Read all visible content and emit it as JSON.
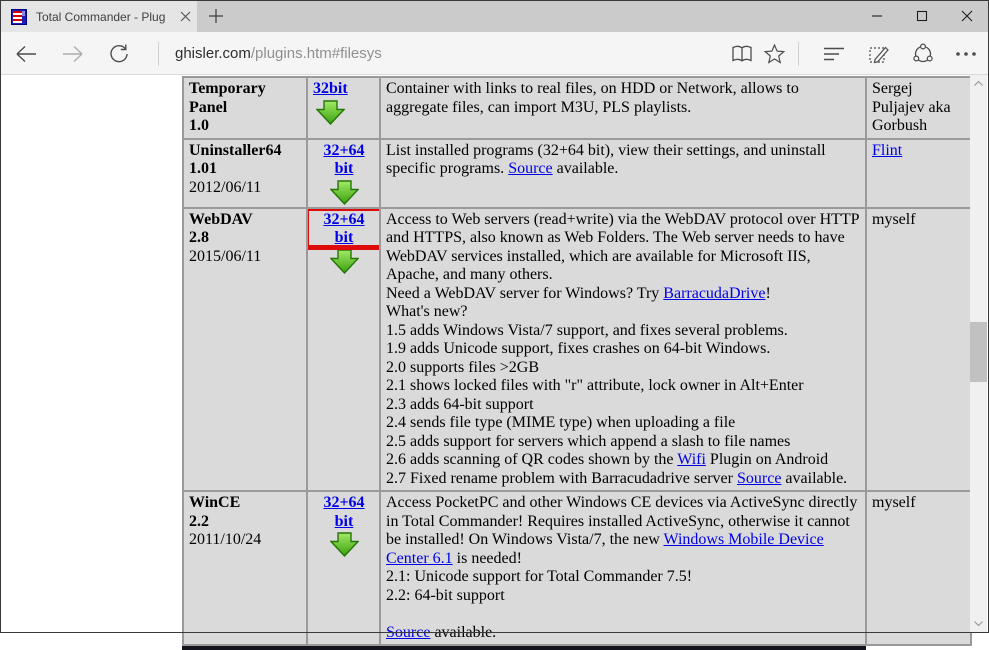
{
  "browser": {
    "tab": {
      "title": "Total Commander - Plug",
      "favicon": "total-commander-floppy-icon"
    },
    "address": {
      "domain": "ghisler.com",
      "path": "/plugins.htm#filesys"
    },
    "icons": {
      "back": "back-arrow-icon",
      "forward": "forward-arrow-icon",
      "refresh": "refresh-icon",
      "reading_view": "book-icon",
      "favorites": "star-icon",
      "hub": "hub-lines-icon",
      "web_note": "pen-note-icon",
      "share": "share-icon",
      "more": "ellipsis-icon",
      "minimize": "minimize-icon",
      "maximize": "maximize-icon",
      "close": "close-icon"
    }
  },
  "colors": {
    "highlight_red": "#de0b0b",
    "link_blue": "#0000e6",
    "cell_gray": "#dadada",
    "arrow_green": "#3ba00e"
  },
  "table": {
    "rows": [
      {
        "name": "Temporary Panel",
        "version": "1.0",
        "date": "",
        "bits": "32bit",
        "highlighted": false,
        "desc_runs": [
          {
            "t": "Container with links to real files, on HDD or Network, allows to aggregate files, can import M3U, PLS playlists."
          }
        ],
        "author_runs": [
          {
            "t": "Sergej Puljajev aka Gorbush"
          }
        ]
      },
      {
        "name": "Uninstaller64",
        "version": "1.01",
        "date": "2012/06/11",
        "bits": "32+64 bit",
        "highlighted": false,
        "desc_runs": [
          {
            "t": "List installed programs (32+64 bit), view their settings, and uninstall specific programs. "
          },
          {
            "l": "Source"
          },
          {
            "t": " available."
          }
        ],
        "author_runs": [
          {
            "l": "Flint"
          }
        ]
      },
      {
        "name": "WebDAV",
        "version": "2.8",
        "date": "2015/06/11",
        "bits": "32+64 bit",
        "highlighted": true,
        "desc_runs": [
          {
            "t": "Access to Web servers (read+write) via the WebDAV protocol over HTTP and HTTPS, also known as Web Folders. The Web server needs to have WebDAV services installed, which are available for Microsoft IIS, Apache, and many others."
          },
          {
            "br": true
          },
          {
            "t": "Need a WebDAV server for Windows? Try "
          },
          {
            "l": "BarracudaDrive"
          },
          {
            "t": "!"
          },
          {
            "br": true
          },
          {
            "t": "What's new?"
          },
          {
            "br": true
          },
          {
            "t": "1.5 adds Windows Vista/7 support, and fixes several problems."
          },
          {
            "br": true
          },
          {
            "t": "1.9 adds Unicode support, fixes crashes on 64-bit Windows."
          },
          {
            "br": true
          },
          {
            "t": "2.0 supports files >2GB"
          },
          {
            "br": true
          },
          {
            "t": "2.1 shows locked files with \"r\" attribute, lock owner in Alt+Enter"
          },
          {
            "br": true
          },
          {
            "t": "2.3 adds 64-bit support"
          },
          {
            "br": true
          },
          {
            "t": "2.4 sends file type (MIME type) when uploading a file"
          },
          {
            "br": true
          },
          {
            "t": "2.5 adds support for servers which append a slash to file names"
          },
          {
            "br": true
          },
          {
            "t": "2.6 adds scanning of QR codes shown by the "
          },
          {
            "l": "Wifi"
          },
          {
            "t": " Plugin on Android"
          },
          {
            "br": true
          },
          {
            "t": "2.7 Fixed rename problem with Barracudadrive server "
          },
          {
            "l": "Source"
          },
          {
            "t": " available."
          }
        ],
        "author_runs": [
          {
            "t": "myself"
          }
        ]
      },
      {
        "name": "WinCE",
        "version": "2.2",
        "date": "2011/10/24",
        "bits": "32+64 bit",
        "highlighted": false,
        "desc_runs": [
          {
            "t": "Access PocketPC and other Windows CE devices via ActiveSync directly in Total Commander! Requires installed ActiveSync, otherwise it cannot be installed! On Windows Vista/7, the new "
          },
          {
            "l": "Windows Mobile Device Center 6.1"
          },
          {
            "t": " is needed!"
          },
          {
            "br": true
          },
          {
            "t": "2.1: Unicode support for Total Commander 7.5!"
          },
          {
            "br": true
          },
          {
            "t": "2.2: 64-bit support"
          },
          {
            "br": true
          },
          {
            "br": true
          },
          {
            "l": "Source"
          },
          {
            "t": " available."
          }
        ],
        "author_runs": [
          {
            "t": "myself"
          }
        ]
      }
    ]
  }
}
